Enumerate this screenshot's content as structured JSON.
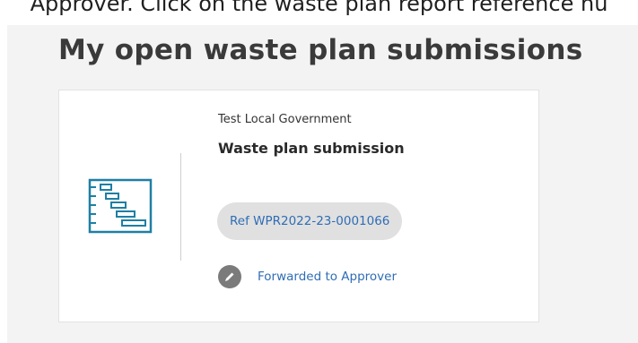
{
  "header": {
    "caption": "Approver. Click on the waste plan report reference nu"
  },
  "section": {
    "title": "My open waste plan submissions"
  },
  "card": {
    "organisation": "Test Local Government",
    "title": "Waste plan submission",
    "reference": "Ref WPR2022-23-0001066",
    "status": "Forwarded to Approver",
    "icon": "gantt-chart-icon",
    "status_icon": "pencil-icon"
  },
  "colors": {
    "accent": "#2f6db5",
    "icon_teal": "#1e7fa3",
    "panel_bg": "#f3f3f3",
    "pill_bg": "#e0e0e0"
  }
}
